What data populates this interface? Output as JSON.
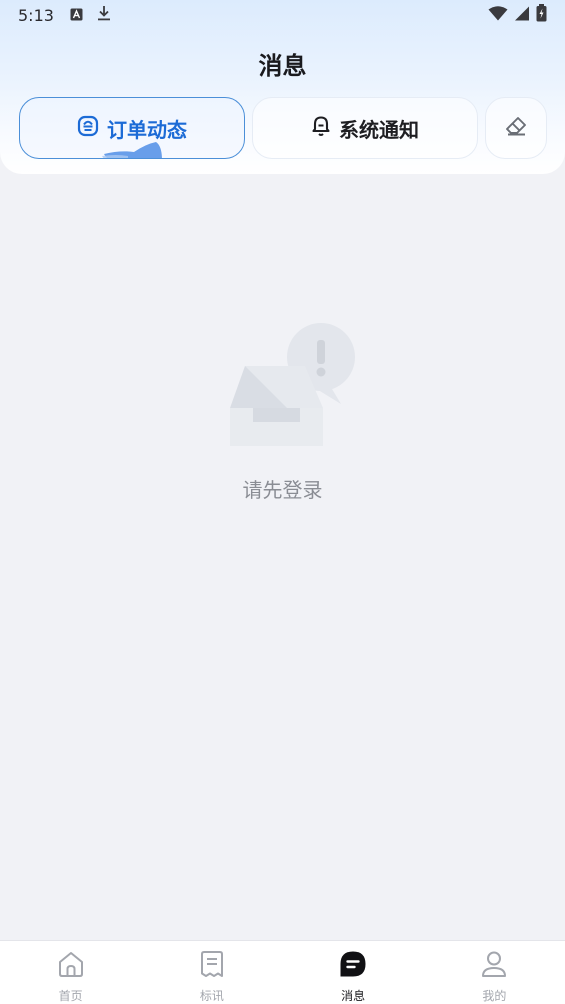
{
  "status_bar": {
    "time": "5:13",
    "left_icons": [
      "a-square-icon",
      "download-icon"
    ],
    "right_icons": [
      "wifi-icon",
      "signal-icon",
      "battery-charging-icon"
    ]
  },
  "header": {
    "title": "消息"
  },
  "tabs": [
    {
      "label": "订单动态",
      "icon": "order-icon",
      "active": true
    },
    {
      "label": "系统通知",
      "icon": "bell-icon",
      "active": false
    }
  ],
  "clear_button": {
    "icon": "eraser-icon"
  },
  "empty_state": {
    "icon": "empty-box-alert-icon",
    "message": "请先登录"
  },
  "bottom_nav": [
    {
      "label": "首页",
      "icon": "home-icon",
      "active": false
    },
    {
      "label": "标讯",
      "icon": "document-icon",
      "active": false
    },
    {
      "label": "消息",
      "icon": "message-icon",
      "active": true
    },
    {
      "label": "我的",
      "icon": "user-icon",
      "active": false
    }
  ],
  "colors": {
    "accent": "#1c6bd6",
    "background": "#f1f2f6",
    "inactive_nav": "#a3a6ad"
  }
}
